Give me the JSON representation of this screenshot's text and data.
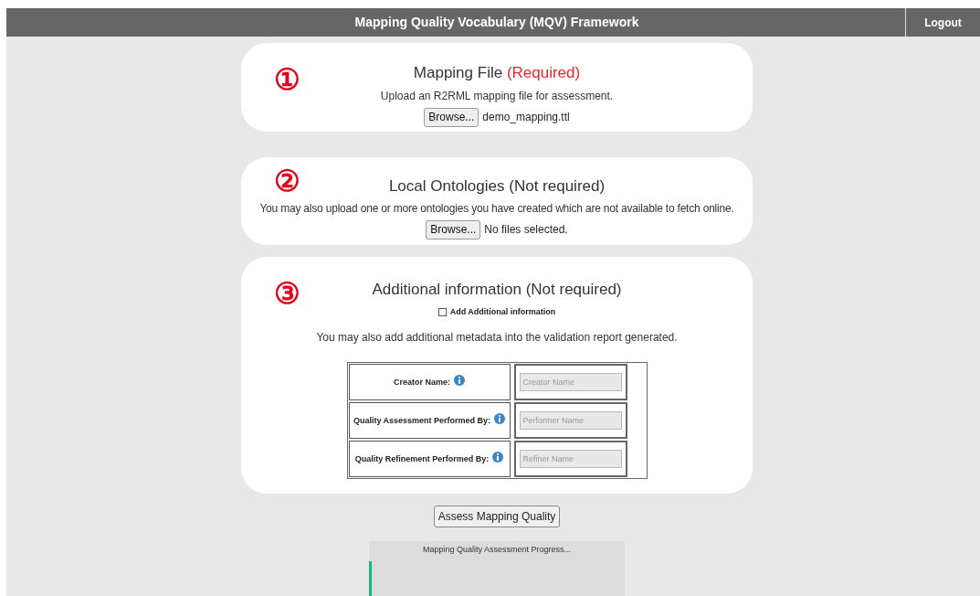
{
  "header": {
    "title": "Mapping Quality Vocabulary (MQV) Framework",
    "logout": "Logout"
  },
  "sections": [
    {
      "number": "①",
      "title": "Mapping File",
      "badge": "(Required)",
      "description": "Upload an R2RML mapping file for assessment.",
      "browse": "Browse...",
      "file_status": "demo_mapping.ttl"
    },
    {
      "number": "②",
      "title": "Local Ontologies (Not required)",
      "description": "You may also upload one or more ontologies you have created which are not available to fetch online.",
      "browse": "Browse...",
      "file_status": "No files selected."
    }
  ],
  "additional": {
    "number": "③",
    "title": "Additional information (Not required)",
    "checkbox": {
      "label": "Add Additional information",
      "checked": false
    },
    "description": "You may also add additional metadata into the validation report generated.",
    "fields": [
      {
        "label": "Creator Name:",
        "placeholder": "Creator Name"
      },
      {
        "label": "Quality Assessment Performed By:",
        "placeholder": "Performer Name"
      },
      {
        "label": "Quality Refinement Performed By:",
        "placeholder": "Refiner Name"
      }
    ]
  },
  "assess_button": "Assess Mapping Quality",
  "progress": {
    "label": "Mapping Quality Assessment Progress...",
    "level": 0.01
  }
}
